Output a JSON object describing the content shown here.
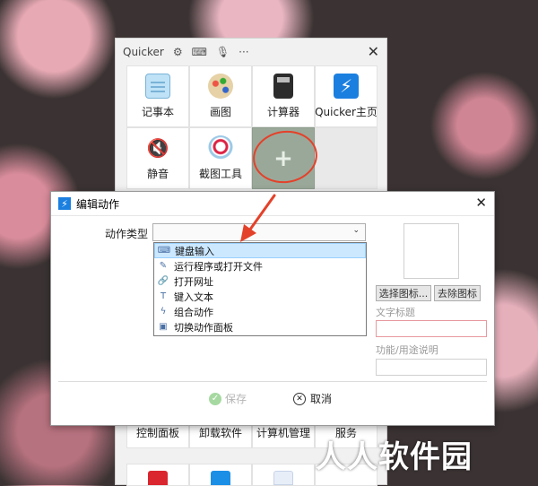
{
  "quicker": {
    "title": "Quicker",
    "toolbar": [
      "⚙",
      "⌨",
      "🎙",
      "···"
    ],
    "close": "✕",
    "tiles": [
      {
        "label": "记事本",
        "icon": "notepad-icon"
      },
      {
        "label": "画图",
        "icon": "paint-icon"
      },
      {
        "label": "计算器",
        "icon": "calculator-icon"
      },
      {
        "label": "Quicker主页",
        "icon": "quicker-icon",
        "glyph": "⚡"
      },
      {
        "label": "静音",
        "icon": "mute-icon",
        "glyph": "🔇"
      },
      {
        "label": "截图工具",
        "icon": "snipping-tool-icon"
      }
    ],
    "add_glyph": "+",
    "bottom_tiles": [
      "控制面板",
      "卸载软件",
      "计算机管理",
      "服务"
    ]
  },
  "dialog": {
    "title": "编辑动作",
    "icon_glyph": "⚡",
    "close": "✕",
    "type_label": "动作类型",
    "chevron": "⌄",
    "options": [
      {
        "label": "键盘输入",
        "icon": "keyboard-icon",
        "glyph": "⌨"
      },
      {
        "label": "运行程序或打开文件",
        "icon": "run-program-icon",
        "glyph": "✎"
      },
      {
        "label": "打开网址",
        "icon": "link-icon",
        "glyph": "🔗"
      },
      {
        "label": "键入文本",
        "icon": "text-icon",
        "glyph": "T"
      },
      {
        "label": "组合动作",
        "icon": "combo-action-icon",
        "glyph": "ϟ"
      },
      {
        "label": "切换动作面板",
        "icon": "panel-switch-icon",
        "glyph": "▣"
      }
    ],
    "select_icon_btn": "选择图标...",
    "remove_icon_btn": "去除图标",
    "text_title_label": "文字标题",
    "desc_label": "功能/用途说明",
    "save": "保存",
    "cancel": "取消",
    "save_glyph": "✓",
    "cancel_glyph": "✕"
  },
  "watermark": "人人软件园",
  "colors": {
    "accent": "#1b7fe0",
    "annotation": "#e4412a",
    "selected_option": "#cce8ff"
  }
}
